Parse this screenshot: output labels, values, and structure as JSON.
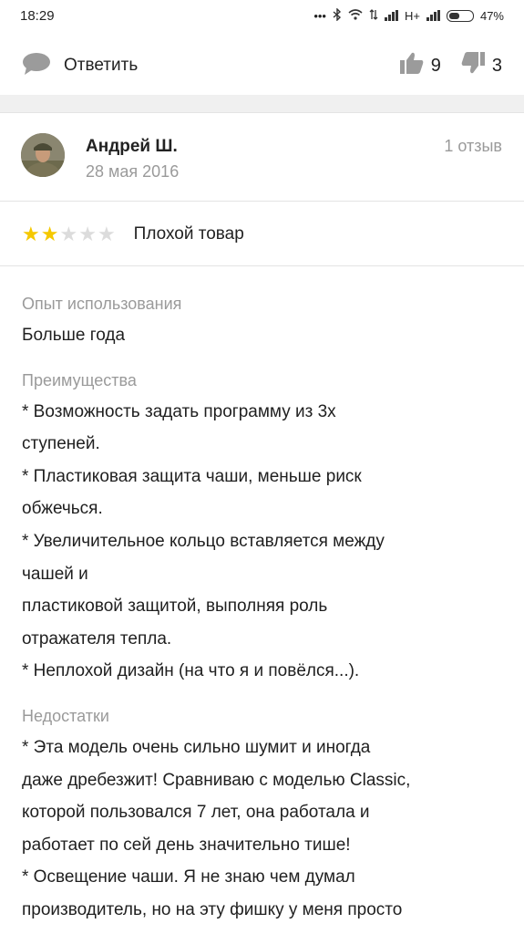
{
  "status": {
    "time": "18:29",
    "network": "H+",
    "battery": "47%"
  },
  "toolbar": {
    "reply_label": "Ответить",
    "likes": "9",
    "dislikes": "3"
  },
  "author": {
    "name": "Андрей Ш.",
    "date": "28 мая 2016",
    "reviews": "1 отзыв"
  },
  "rating": {
    "stars": 2,
    "max": 5,
    "label": "Плохой товар"
  },
  "sections": [
    {
      "title": "Опыт использования",
      "lines": [
        "Больше года"
      ]
    },
    {
      "title": "Преимущества",
      "lines": [
        "* Возможность задать программу из 3х",
        "ступеней.",
        "* Пластиковая защита чаши, меньше риск",
        "обжечься.",
        "* Увеличительное кольцо вставляется между",
        "чашей и",
        "пластиковой защитой, выполняя роль",
        "отражателя тепла.",
        "* Неплохой дизайн (на что я и повёлся...)."
      ]
    },
    {
      "title": "Недостатки",
      "lines": [
        "* Эта модель очень сильно шумит и иногда",
        "даже дребезжит! Сравниваю с моделью Classic,",
        "которой пользовался 7 лет, она работала и",
        "работает по сей день значительно тише!",
        "* Освещение чаши. Я не знаю чем думал",
        "производитель, но на эту фишку у меня просто"
      ]
    }
  ],
  "colors": {
    "star_on": "#f5c800",
    "star_off": "#dcdcdc",
    "muted": "#9a9a9a",
    "divider": "#e3e3e3"
  }
}
